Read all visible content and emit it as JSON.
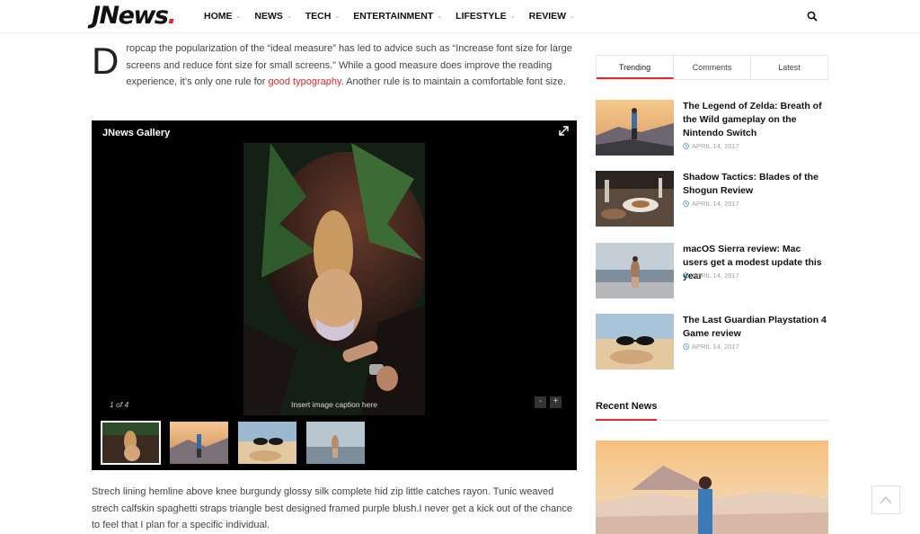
{
  "header": {
    "logo_text": "JNews",
    "logo_dot": ".",
    "nav": [
      {
        "label": "HOME"
      },
      {
        "label": "NEWS"
      },
      {
        "label": "TECH"
      },
      {
        "label": "ENTERTAINMENT"
      },
      {
        "label": "LIFESTYLE"
      },
      {
        "label": "REVIEW"
      }
    ],
    "search_icon": "search-icon"
  },
  "article": {
    "dropcap": "D",
    "para1_before": "ropcap the popularization of the “ideal measure” has led to advice such as “Increase font size for large screens and reduce font size for small screens.” While a good measure does improve the reading experience, it’s only one rule for ",
    "para1_link": "good typography",
    "para1_after": ". Another rule is to maintain a comfortable font size.",
    "para2": "Strech lining hemline above knee burgundy glossy silk complete hid zip little catches rayon. Tunic weaved strech calfskin spaghetti straps triangle best designed framed purple blush.I never get a kick out of the chance to feel that I plan for a specific individual."
  },
  "gallery": {
    "title": "JNews Gallery",
    "caption": "Insert image caption here",
    "counter": "1 of 4",
    "zoom_out": "-",
    "zoom_in": "+",
    "colors": {
      "accent": "#e8282b",
      "background": "#000000"
    }
  },
  "sidebar": {
    "tabs": [
      {
        "label": "Trending",
        "active": true
      },
      {
        "label": "Comments",
        "active": false
      },
      {
        "label": "Latest",
        "active": false
      }
    ],
    "posts": [
      {
        "title": "The Legend of Zelda: Breath of the Wild gameplay on the Nintendo Switch",
        "date": "APRIL 14, 2017"
      },
      {
        "title": "Shadow Tactics: Blades of the Shogun Review",
        "date": "APRIL 14, 2017"
      },
      {
        "title": "macOS Sierra review: Mac users get a modest update this year",
        "date": "APRIL 14, 2017"
      },
      {
        "title": "The Last Guardian Playstation 4 Game review",
        "date": "APRIL 14, 2017"
      }
    ],
    "recent_title": "Recent News"
  }
}
